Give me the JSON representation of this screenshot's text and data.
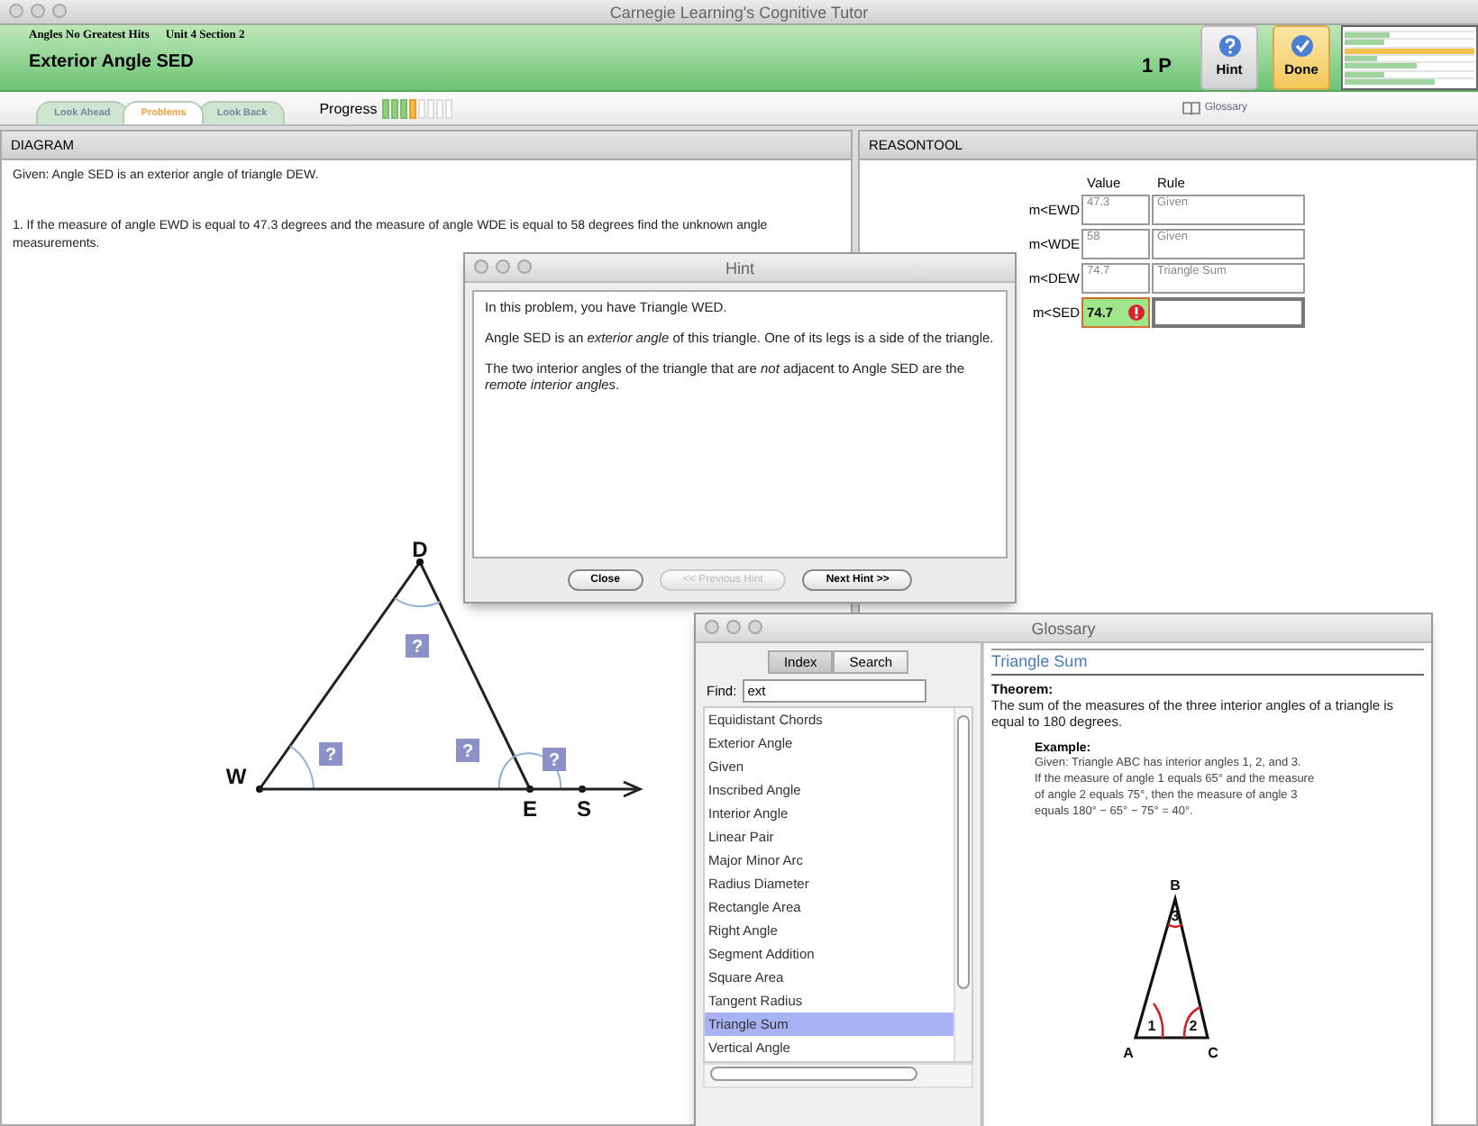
{
  "window": {
    "title": "Carnegie Learning's Cognitive Tutor"
  },
  "header": {
    "unit": "Angles No Greatest Hits",
    "section": "Unit 4 Section 2",
    "problem_title": "Exterior Angle SED",
    "points": "1 P",
    "buttons": [
      {
        "kind": "hint",
        "label": "Hint"
      },
      {
        "kind": "done",
        "label": "Done"
      }
    ]
  },
  "skills": [
    {
      "level": 0.35,
      "highlighted": false
    },
    {
      "level": 0.3,
      "highlighted": false
    },
    {
      "level": 1,
      "highlighted": true
    },
    {
      "level": 0.25,
      "highlighted": false
    },
    {
      "level": 0.55,
      "highlighted": false
    },
    {
      "level": 0.3,
      "highlighted": false
    },
    {
      "level": 0.7,
      "highlighted": false
    }
  ],
  "tabs": [
    {
      "label": "Look Ahead",
      "selected": false
    },
    {
      "label": "Problems",
      "selected": true
    },
    {
      "label": "Look Back",
      "selected": false
    }
  ],
  "progress": {
    "label": "Progress",
    "segments": [
      {
        "done": true,
        "current": false
      },
      {
        "done": true,
        "current": false
      },
      {
        "done": true,
        "current": false
      },
      {
        "done": false,
        "current": true
      },
      {
        "done": false,
        "current": false
      },
      {
        "done": false,
        "current": false
      },
      {
        "done": false,
        "current": false
      },
      {
        "done": false,
        "current": false
      }
    ]
  },
  "glossary_link": "Glossary",
  "diagram": {
    "title": "DIAGRAM",
    "given": "Given: Angle SED is an exterior angle of triangle DEW.",
    "question": "1. If the measure of angle EWD is equal to 47.3 degrees and the measure of angle WDE is equal to 58 degrees find the unknown angle measurements.",
    "points": [
      "D",
      "W",
      "E",
      "S"
    ],
    "unknown_marks": [
      "?",
      "?",
      "?",
      "?"
    ]
  },
  "reasontool": {
    "title": "REASONTOOL",
    "columns": [
      "Value",
      "Rule"
    ],
    "rows": [
      {
        "label": "m<EWD",
        "value": "47.3",
        "rule": "Given",
        "flagged": false
      },
      {
        "label": "m<WDE",
        "value": "58",
        "rule": "Given",
        "flagged": false
      },
      {
        "label": "m<DEW",
        "value": "74.7",
        "rule": "Triangle Sum",
        "flagged": false
      },
      {
        "label": "m<SED",
        "value": "74.7",
        "flagged": true
      }
    ]
  },
  "hint_window": {
    "title": "Hint",
    "paragraphs": [
      "In this problem, you have Triangle WED.",
      "Angle SED is an *exterior angle* of this triangle. One of its legs is a side of the triangle.",
      "The two interior angles of the triangle that are *not* adjacent to Angle SED are the *remote interior angles*."
    ],
    "buttons": [
      {
        "label": "Close",
        "disabled": false
      },
      {
        "label": "<< Previous Hint",
        "disabled": true
      },
      {
        "label": "Next Hint >>",
        "disabled": false
      }
    ]
  },
  "glossary_window": {
    "title": "Glossary",
    "tabs": [
      {
        "label": "Index",
        "selected": true
      },
      {
        "label": "Search",
        "selected": false
      }
    ],
    "find": {
      "label": "Find:",
      "value": "ext"
    },
    "items": [
      {
        "label": "Equidistant Chords",
        "selected": false
      },
      {
        "label": "Exterior Angle",
        "selected": false
      },
      {
        "label": "Given",
        "selected": false
      },
      {
        "label": "Inscribed Angle",
        "selected": false
      },
      {
        "label": "Interior Angle",
        "selected": false
      },
      {
        "label": "Linear Pair",
        "selected": false
      },
      {
        "label": "Major Minor Arc",
        "selected": false
      },
      {
        "label": "Radius Diameter",
        "selected": false
      },
      {
        "label": "Rectangle Area",
        "selected": false
      },
      {
        "label": "Right Angle",
        "selected": false
      },
      {
        "label": "Segment Addition",
        "selected": false
      },
      {
        "label": "Square Area",
        "selected": false
      },
      {
        "label": "Tangent Radius",
        "selected": false
      },
      {
        "label": "Triangle Sum",
        "selected": true
      },
      {
        "label": "Vertical Angle",
        "selected": false
      }
    ],
    "entry": {
      "title": "Triangle Sum",
      "heading": "Theorem:",
      "text": "The sum of the measures of the three interior angles of a triangle is equal to 180 degrees.",
      "example_heading": "Example:",
      "example_lines": [
        "Given: Triangle ABC has interior angles 1, 2, and 3.",
        "If the measure of angle 1 equals 65° and the measure",
        "of angle 2 equals 75°, then the measure of angle 3",
        "equals 180° − 65° − 75° = 40°."
      ],
      "figure": {
        "vertices": [
          "A",
          "B",
          "C"
        ],
        "angles": [
          "1",
          "2",
          "3"
        ]
      }
    }
  }
}
